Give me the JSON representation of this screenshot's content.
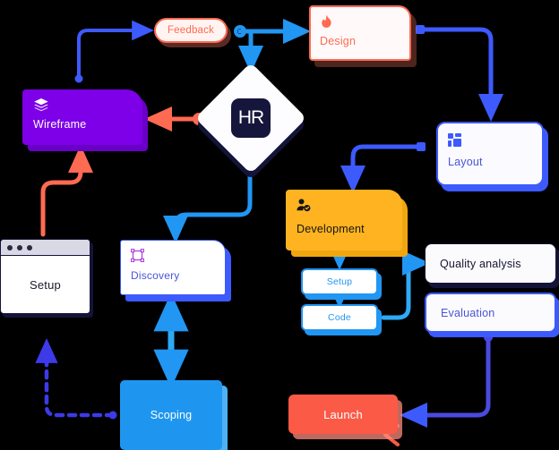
{
  "diagram": {
    "title": "HR workflow flowchart",
    "nodes": {
      "feedback": {
        "label": "Feedback",
        "icon": "",
        "color": "#ff6a52"
      },
      "design": {
        "label": "Design",
        "icon": "flame-icon",
        "color": "#ff6a52"
      },
      "wireframe": {
        "label": "Wireframe",
        "icon": "layers-icon",
        "color": "#7d00e8"
      },
      "hr": {
        "label": "HR",
        "icon": "hr-logo-icon",
        "color": "#16163c"
      },
      "layout": {
        "label": "Layout",
        "icon": "grid-icon",
        "color": "#3d5afe"
      },
      "development": {
        "label": "Development",
        "icon": "user-settings-icon",
        "color": "#ffb320"
      },
      "discovery": {
        "label": "Discovery",
        "icon": "frame-select-icon",
        "color": "#3d5afe"
      },
      "setup_window": {
        "label": "Setup",
        "icon": "browser-window-icon",
        "color": "#14143a"
      },
      "sub_setup": {
        "label": "Setup",
        "icon": "",
        "color": "#2196f3"
      },
      "sub_code": {
        "label": "Code",
        "icon": "",
        "color": "#2196f3"
      },
      "quality": {
        "label": "Quality analysis",
        "icon": "",
        "color": "#14143a"
      },
      "evaluation": {
        "label": "Evaluation",
        "icon": "",
        "color": "#3d5afe"
      },
      "scoping": {
        "label": "Scoping",
        "icon": "",
        "color": "#1e96f0"
      },
      "launch": {
        "label": "Launch",
        "icon": "",
        "color": "#fa5a46"
      }
    },
    "palette": {
      "background": "#000000",
      "blue": "#2196f3",
      "indigo": "#3d5afe",
      "coral": "#ff6a52",
      "purple": "#7d00e8",
      "amber": "#ffb320",
      "navy": "#14143a",
      "red": "#fa5a46"
    },
    "connectors": [
      {
        "from": "wireframe",
        "to": "feedback",
        "style": "solid",
        "color": "#3d5afe"
      },
      {
        "from": "feedback",
        "to": "design",
        "style": "solid",
        "color": "#2196f3"
      },
      {
        "from": "design",
        "to": "layout",
        "style": "solid",
        "color": "#3d5afe"
      },
      {
        "from": "hr",
        "to": "wireframe",
        "style": "solid",
        "color": "#ff6a52"
      },
      {
        "from": "hr",
        "to": "discovery",
        "style": "solid",
        "color": "#2196f3"
      },
      {
        "from": "hr",
        "to": "design",
        "style": "solid",
        "color": "#2196f3"
      },
      {
        "from": "layout",
        "to": "development",
        "style": "solid",
        "color": "#3d5afe"
      },
      {
        "from": "setup_window",
        "to": "wireframe",
        "style": "solid",
        "color": "#ff6a52"
      },
      {
        "from": "discovery",
        "to": "scoping",
        "style": "solid",
        "color": "#2196f3"
      },
      {
        "from": "scoping",
        "to": "setup_window",
        "style": "dashed",
        "color": "#3d3ae8"
      },
      {
        "from": "development",
        "to": "sub_setup",
        "style": "solid",
        "color": "#2196f3"
      },
      {
        "from": "sub_setup",
        "to": "sub_code",
        "style": "solid",
        "color": "#2196f3"
      },
      {
        "from": "sub_code",
        "to": "quality",
        "style": "solid",
        "color": "#2196f3"
      },
      {
        "from": "evaluation",
        "to": "launch",
        "style": "solid",
        "color": "#4a4ae0"
      }
    ]
  }
}
